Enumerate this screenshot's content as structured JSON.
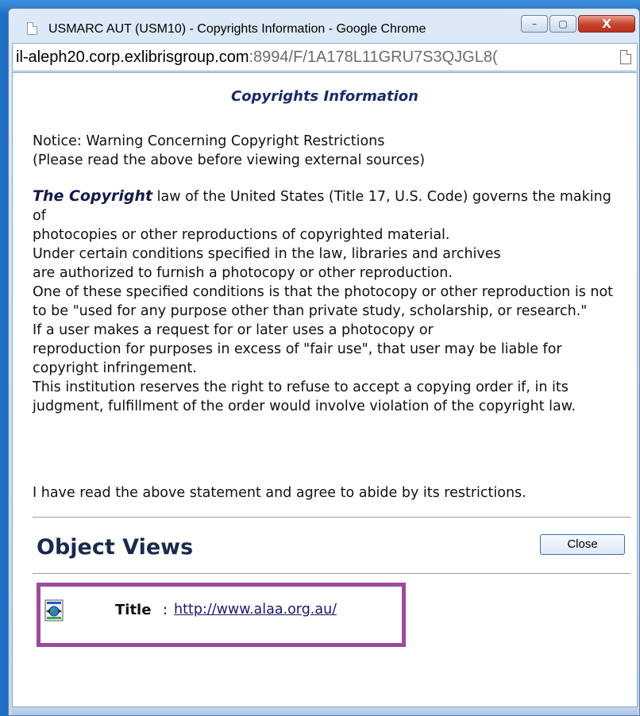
{
  "window": {
    "title": "USMARC AUT (USM10) - Copyrights Information - Google Chrome",
    "controls": {
      "minimize": "–",
      "maximize": "▢",
      "close": "X"
    }
  },
  "address_bar": {
    "url_host": "il-aleph20.corp.exlibrisgroup.com",
    "url_rest": ":8994/F/1A178L11GRU7S3QJGL8("
  },
  "page": {
    "heading": "Copyrights Information",
    "notice_lines": [
      "Notice: Warning Concerning Copyright Restrictions",
      "(Please read the above before viewing external sources)"
    ],
    "lead_phrase": "The Copyright",
    "body_lines": [
      " law of the United States (Title 17, U.S. Code) governs the making of",
      "photocopies or other reproductions of copyrighted material.",
      "Under certain conditions specified in the law, libraries and archives",
      "are authorized to furnish a photocopy or other reproduction.",
      "One of these specified conditions is that the photocopy or other reproduction is not to be \"used for any purpose other than private study, scholarship, or research.\"",
      "If a user makes a request for or later uses a photocopy or",
      "reproduction for purposes in excess of \"fair use\", that user may be liable for copyright infringement.",
      "This institution reserves the right to refuse to accept a copying order if, in its judgment, fulfillment of the order would involve violation of the copyright law."
    ],
    "agreement": "I have read the above statement and agree to abide by its restrictions.",
    "section_title": "Object Views",
    "close_label": "Close",
    "object": {
      "field_label": "Title",
      "separator": ":",
      "link_text": "http://www.alaa.org.au/"
    }
  },
  "colors": {
    "highlight_border": "#9b4aa0",
    "heading_text": "#1a2a6b",
    "link": "#1a1a6e"
  }
}
